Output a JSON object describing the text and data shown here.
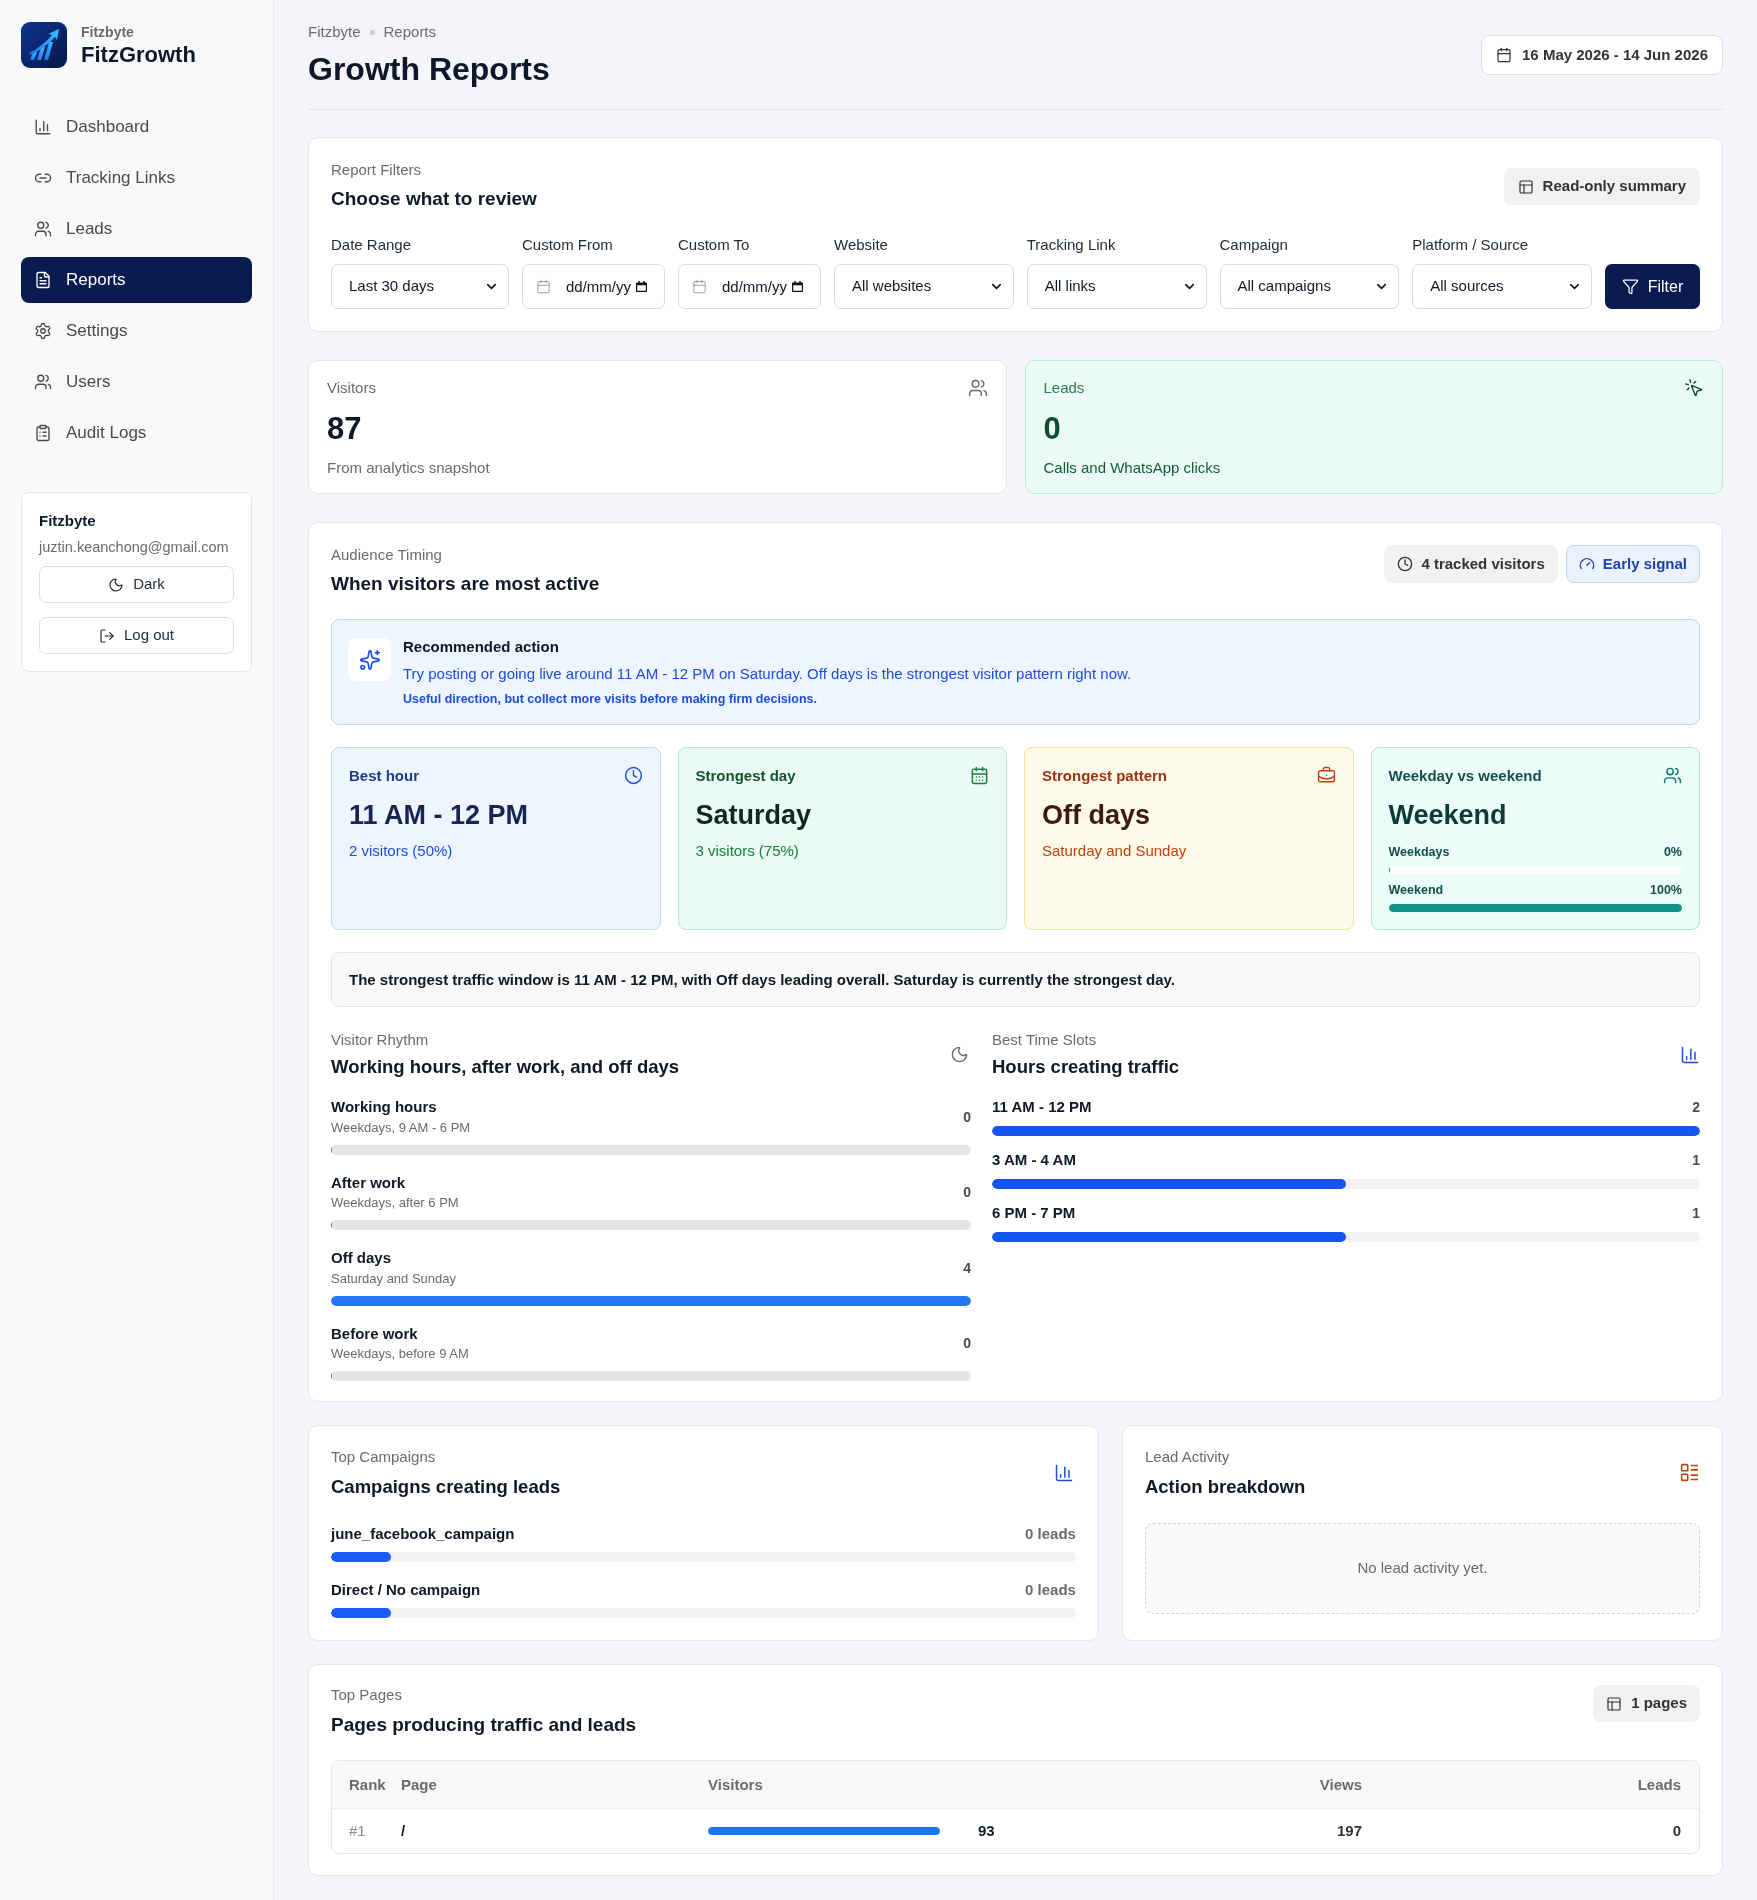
{
  "sidebar": {
    "brand_org": "Fitzbyte",
    "brand_name": "FitzGrowth",
    "nav": [
      {
        "label": "Dashboard",
        "selected": false
      },
      {
        "label": "Tracking Links",
        "selected": false
      },
      {
        "label": "Leads",
        "selected": false
      },
      {
        "label": "Reports",
        "selected": true
      },
      {
        "label": "Settings",
        "selected": false
      },
      {
        "label": "Users",
        "selected": false
      },
      {
        "label": "Audit Logs",
        "selected": false
      }
    ],
    "account": {
      "name": "Fitzbyte",
      "email": "juztin.keanchong@gmail.com",
      "buttons": [
        "Dark",
        "Log out"
      ]
    }
  },
  "header": {
    "breadcrumb": [
      "Fitzbyte",
      "Reports"
    ],
    "title": "Growth Reports",
    "date_range": "16 May 2026 - 14 Jun 2026"
  },
  "filters": {
    "eyebrow": "Report Filters",
    "title": "Choose what to review",
    "badge": "Read-only summary",
    "fields": [
      {
        "kind": "select",
        "label": "Date Range",
        "value": "Last 30 days"
      },
      {
        "kind": "date",
        "label": "Custom From",
        "placeholder": "dd/mm/yy"
      },
      {
        "kind": "date",
        "label": "Custom To",
        "placeholder": "dd/mm/yy"
      },
      {
        "kind": "select",
        "label": "Website",
        "value": "All websites"
      },
      {
        "kind": "select",
        "label": "Tracking Link",
        "value": "All links"
      },
      {
        "kind": "select",
        "label": "Campaign",
        "value": "All campaigns"
      },
      {
        "kind": "select",
        "label": "Platform / Source",
        "value": "All sources"
      }
    ],
    "button": "Filter"
  },
  "kpis": [
    {
      "kind": "plain",
      "label": "Visitors",
      "value": "87",
      "note": "From analytics snapshot"
    },
    {
      "kind": "success",
      "label": "Leads",
      "value": "0",
      "note": "Calls and WhatsApp clicks"
    }
  ],
  "audience": {
    "eyebrow": "Audience Timing",
    "title": "When visitors are most active",
    "badges": [
      {
        "kind": "neutral",
        "label": "4 tracked visitors"
      },
      {
        "kind": "info",
        "label": "Early signal"
      }
    ],
    "recommendation": {
      "title": "Recommended action",
      "text": "Try posting or going live around 11 AM - 12 PM on Saturday. Off days is the strongest visitor pattern right now.",
      "note": "Useful direction, but collect more visits before making firm decisions."
    },
    "stats": [
      {
        "kind": "hour",
        "label": "Best hour",
        "value": "11 AM - 12 PM",
        "note": "2 visitors (50%)"
      },
      {
        "kind": "day",
        "label": "Strongest day",
        "value": "Saturday",
        "note": "3 visitors (75%)"
      },
      {
        "kind": "pattern",
        "label": "Strongest pattern",
        "value": "Off days",
        "note": "Saturday and Sunday"
      },
      {
        "kind": "split",
        "label": "Weekday vs weekend",
        "value": "Weekend",
        "bars": [
          {
            "label": "Weekdays",
            "reading": "0%",
            "level": 0
          },
          {
            "label": "Weekend",
            "reading": "100%",
            "level": 1
          }
        ]
      }
    ],
    "summary": "The strongest traffic window is 11 AM - 12 PM, with Off days leading overall. Saturday is currently the strongest day.",
    "rhythm": {
      "eyebrow": "Visitor Rhythm",
      "title": "Working hours, after work, and off days",
      "rows": [
        {
          "label": "Working hours",
          "sub": "Weekdays, 9 AM - 6 PM",
          "count": "0",
          "level": 0
        },
        {
          "label": "After work",
          "sub": "Weekdays, after 6 PM",
          "count": "0",
          "level": 0
        },
        {
          "label": "Off days",
          "sub": "Saturday and Sunday",
          "count": "4",
          "level": 1
        },
        {
          "label": "Before work",
          "sub": "Weekdays, before 9 AM",
          "count": "0",
          "level": 0
        }
      ]
    },
    "slots": {
      "eyebrow": "Best Time Slots",
      "title": "Hours creating traffic",
      "rows": [
        {
          "label": "11 AM - 12 PM",
          "count": "2",
          "level": 1
        },
        {
          "label": "3 AM - 4 AM",
          "count": "1",
          "level": 0.5
        },
        {
          "label": "6 PM - 7 PM",
          "count": "1",
          "level": 0.5
        }
      ]
    }
  },
  "campaigns": {
    "eyebrow": "Top Campaigns",
    "title": "Campaigns creating leads",
    "rows": [
      {
        "name": "june_facebook_campaign",
        "reading": "0 leads",
        "level": 0.08
      },
      {
        "name": "Direct / No campaign",
        "reading": "0 leads",
        "level": 0.08
      }
    ]
  },
  "lead_activity": {
    "eyebrow": "Lead Activity",
    "title": "Action breakdown",
    "empty": "No lead activity yet."
  },
  "pages": {
    "eyebrow": "Top Pages",
    "title": "Pages producing traffic and leads",
    "badge": "1 pages",
    "columns": [
      "Rank",
      "Page",
      "Visitors",
      "Views",
      "Leads"
    ],
    "rows": [
      {
        "rank": "#1",
        "page": "/",
        "visitors": "93",
        "level": 1,
        "views": "197",
        "leads": "0"
      }
    ]
  }
}
